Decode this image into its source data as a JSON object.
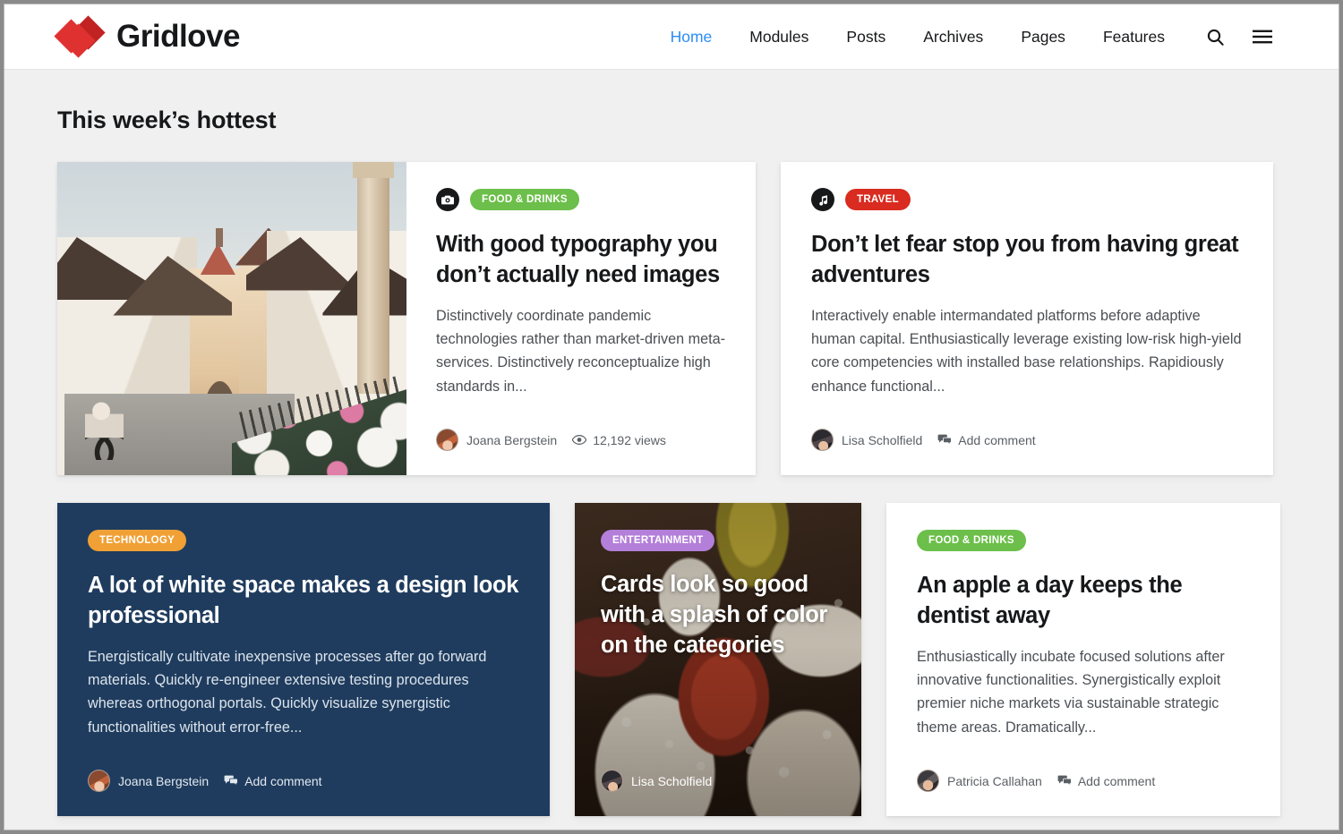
{
  "header": {
    "brand_name": "Gridlove",
    "nav": [
      {
        "label": "Home",
        "active": true
      },
      {
        "label": "Modules",
        "active": false
      },
      {
        "label": "Posts",
        "active": false
      },
      {
        "label": "Archives",
        "active": false
      },
      {
        "label": "Pages",
        "active": false
      },
      {
        "label": "Features",
        "active": false
      }
    ],
    "search_icon": "search-icon",
    "menu_icon": "hamburger-menu-icon",
    "active_color": "#2d8cf5"
  },
  "section": {
    "title": "This week’s hottest"
  },
  "cards": [
    {
      "format_icon": "camera-icon",
      "category": "FOOD & DRINKS",
      "category_color": "#6cbf4a",
      "title": "With good typography you don’t actually need images",
      "excerpt": "Distinctively coordinate pandemic technologies rather than market-driven meta-services. Distinctively reconceptualize high standards in...",
      "author": "Joana Bergstein",
      "meta_icon": "eye-icon",
      "meta_text": "12,192 views"
    },
    {
      "format_icon": "music-note-icon",
      "category": "TRAVEL",
      "category_color": "#d92b20",
      "title": "Don’t let fear stop you from having great adventures",
      "excerpt": "Interactively enable intermandated platforms before adaptive human capital. Enthusiastically leverage existing low-risk high-yield core competencies with installed base relationships. Rapidiously enhance functional...",
      "author": "Lisa Scholfield",
      "meta_icon": "comment-icon",
      "meta_text": "Add comment"
    },
    {
      "category": "TECHNOLOGY",
      "category_color": "#f0a035",
      "background_color": "#1f3c5e",
      "title": "A lot of white space makes a design look professional",
      "excerpt": "Energistically cultivate inexpensive processes after go forward materials. Quickly re-engineer extensive testing procedures whereas orthogonal portals. Quickly visualize synergistic functionalities without error-free...",
      "author": "Joana Bergstein",
      "meta_icon": "comment-icon",
      "meta_text": "Add comment"
    },
    {
      "category": "ENTERTAINMENT",
      "category_color": "#b37fd9",
      "title": "Cards look so good with a splash of color on the categories",
      "author": "Lisa Scholfield"
    },
    {
      "category": "FOOD & DRINKS",
      "category_color": "#6cbf4a",
      "title": "An apple a day keeps the dentist away",
      "excerpt": "Enthusiastically incubate focused solutions after innovative functionalities. Synergistically exploit premier niche markets via sustainable strategic theme areas. Dramatically...",
      "author": "Patricia Callahan",
      "meta_icon": "comment-icon",
      "meta_text": "Add comment"
    }
  ]
}
